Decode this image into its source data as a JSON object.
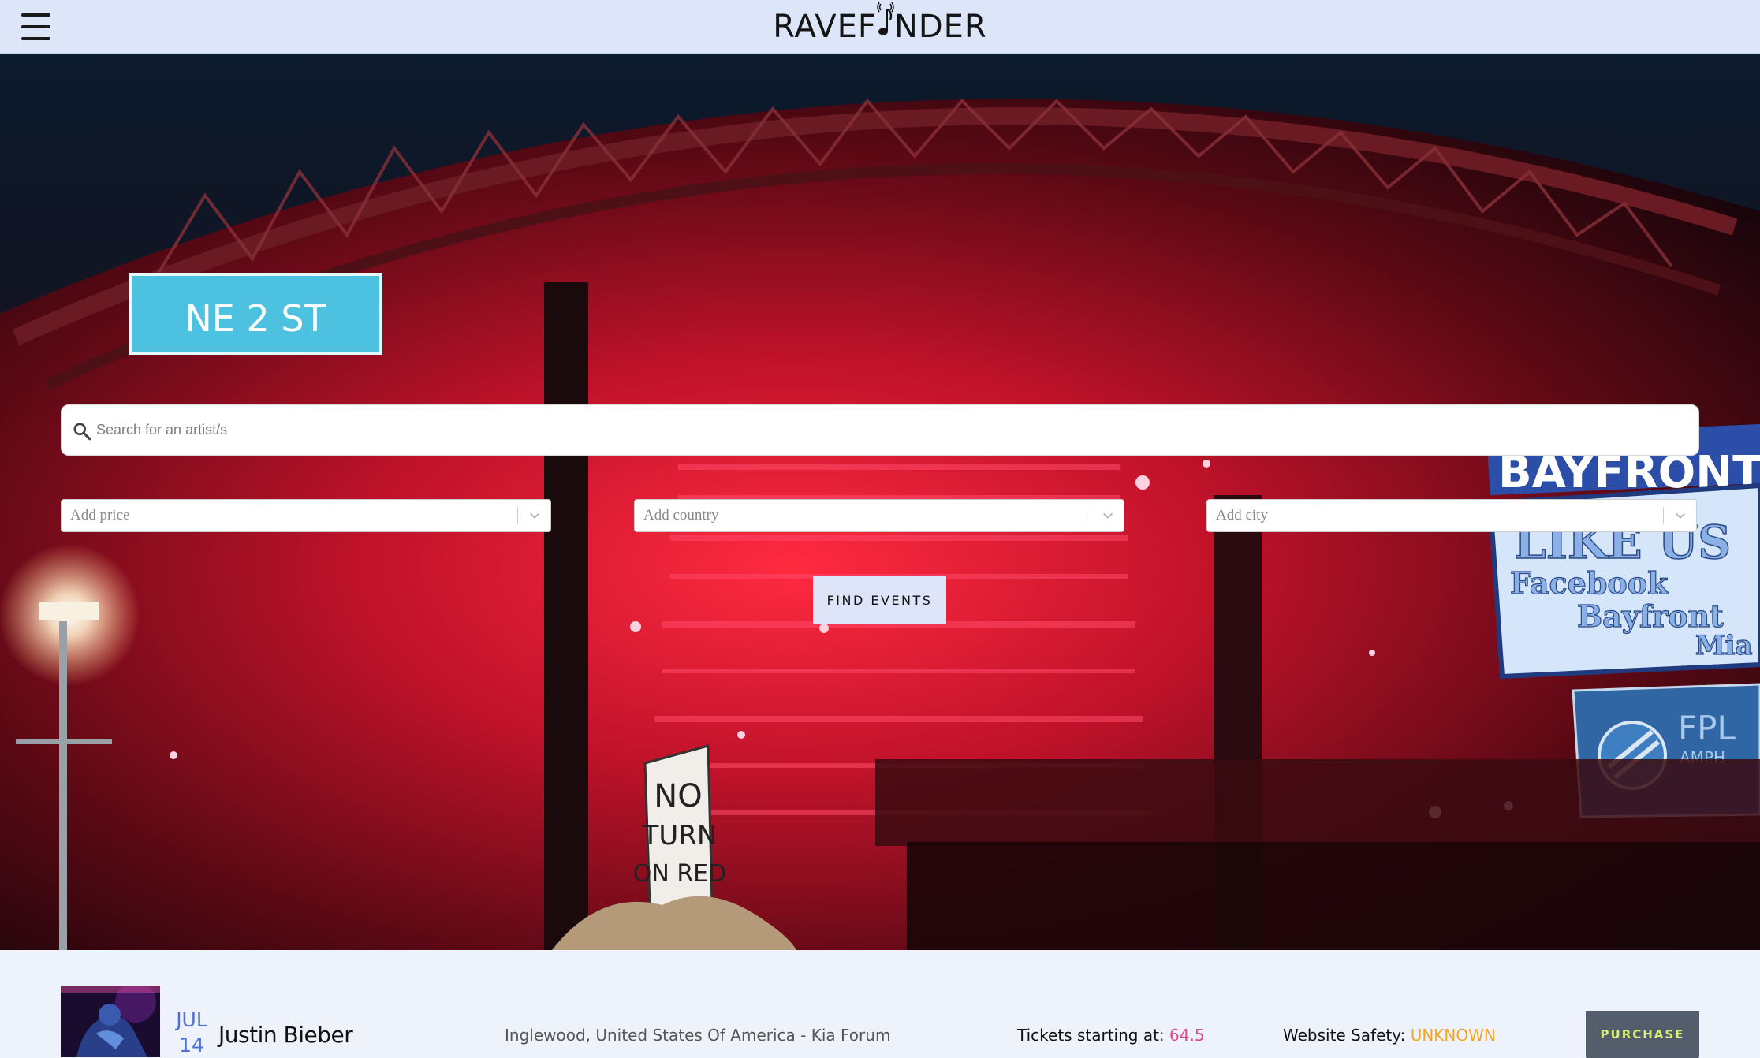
{
  "header": {
    "logo_text_left": "RAVEF",
    "logo_text_right": "NDER",
    "menu_icon": "hamburger-menu-icon"
  },
  "hero": {
    "background_theme": "red-lit concert stage at night",
    "search": {
      "placeholder": "Search for an artist/s",
      "icon": "search-icon"
    },
    "filters": {
      "price_placeholder": "Add price",
      "country_placeholder": "Add country",
      "city_placeholder": "Add city"
    },
    "find_button_label": "FIND EVENTS",
    "scene_signs": {
      "street_sign": "NE 2 ST",
      "no_turn_line1": "NO",
      "no_turn_line2": "TURN",
      "no_turn_line3": "ON RED",
      "billboard_line1": "LIKE US",
      "billboard_line2": "Facebook",
      "billboard_line3": "Bayfront",
      "billboard_line4": "Mia",
      "marquee": "BAYFRONT",
      "fpl": "FPL",
      "fpl_sub": "AMPH"
    }
  },
  "events": [
    {
      "month": "JUL",
      "day": "14",
      "artist": "Justin Bieber",
      "venue": "Inglewood, United States Of America - Kia Forum",
      "tickets_label": "Tickets starting at: ",
      "tickets_price": "64.5",
      "safety_label": "Website Safety: ",
      "safety_value": "UNKNOWN",
      "purchase_label": "PURCHASE"
    }
  ],
  "colors": {
    "header_bg": "#dce6f8",
    "page_bg": "#eef2fb",
    "date_blue": "#4f6fd7",
    "price_pink": "#e0478f",
    "safety_orange": "#f4a51c",
    "purchase_bg": "#545d6c",
    "purchase_text": "#d8f07a",
    "find_btn_bg": "#dfe5f8"
  }
}
